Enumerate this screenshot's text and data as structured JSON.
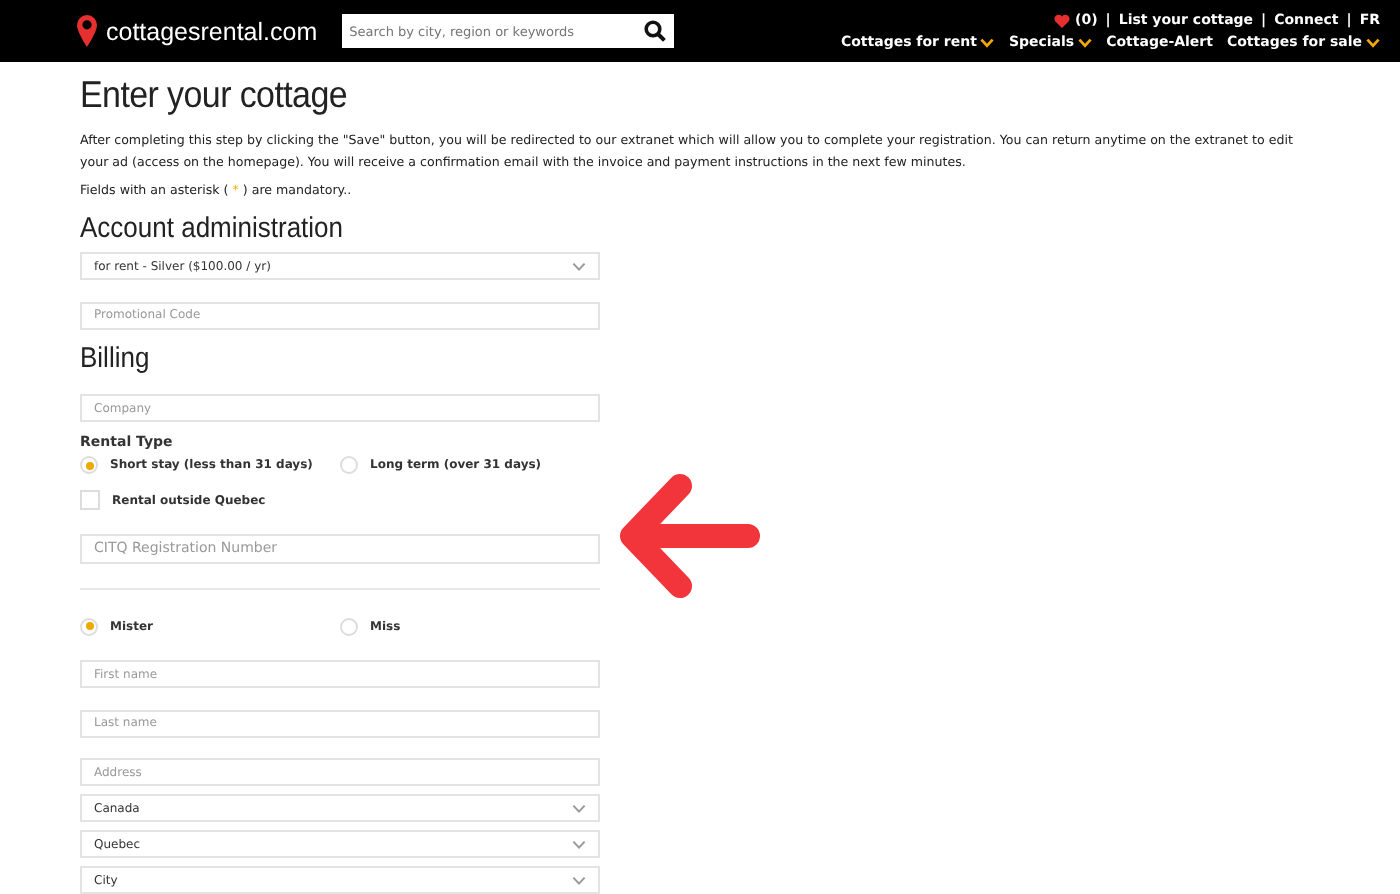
{
  "header": {
    "logo": "cottagesrental.com",
    "search": {
      "placeholder": "Search by city, region or keywords"
    },
    "favorites": "(0)",
    "separator": "|",
    "top_links": [
      "List your cottage",
      "Connect",
      "FR"
    ],
    "nav": [
      {
        "label": "Cottages for rent",
        "dropdown": true
      },
      {
        "label": "Specials",
        "dropdown": true
      },
      {
        "label": "Cottage-Alert",
        "dropdown": false
      },
      {
        "label": "Cottages for sale",
        "dropdown": true
      }
    ]
  },
  "title": "Enter your cottage",
  "intro": "After completing this step by clicking the \"Save\" button, you will be redirected to our extranet which will allow you to complete your registration. You can return anytime on the extranet to edit your ad (access on the homepage). You will receive a confirmation email with the invoice and payment instructions in the next few minutes.",
  "mandatory_note": {
    "before": "Fields with an asterisk (",
    "mark": "*",
    "after": ") are mandatory.."
  },
  "sections": [
    {
      "heading": "Account administration",
      "fields": [
        {
          "kind": "select",
          "value": "for rent - Silver ($100.00 / yr)"
        },
        {
          "kind": "input",
          "placeholder": "Promotional Code"
        }
      ]
    },
    {
      "heading": "Billing",
      "fields": [
        {
          "kind": "input",
          "placeholder": "Company"
        },
        {
          "kind": "label",
          "text": "Rental Type"
        },
        {
          "kind": "radios",
          "options": [
            {
              "label": "Short stay (less than 31 days)",
              "selected": true
            },
            {
              "label": "Long term (over 31 days)",
              "selected": false
            }
          ]
        },
        {
          "kind": "checkbox",
          "label": "Rental outside Quebec",
          "checked": false
        },
        {
          "kind": "input",
          "placeholder": "CITQ Registration Number",
          "highlighted": true
        },
        {
          "kind": "divider"
        },
        {
          "kind": "radios",
          "options": [
            {
              "label": "Mister",
              "selected": true
            },
            {
              "label": "Miss",
              "selected": false
            }
          ]
        },
        {
          "kind": "input",
          "placeholder": "First name"
        },
        {
          "kind": "input",
          "placeholder": "Last name"
        },
        {
          "kind": "input",
          "placeholder": "Address"
        },
        {
          "kind": "select",
          "value": "Canada"
        },
        {
          "kind": "select",
          "value": "Quebec"
        },
        {
          "kind": "select",
          "value": "City"
        }
      ]
    }
  ]
}
